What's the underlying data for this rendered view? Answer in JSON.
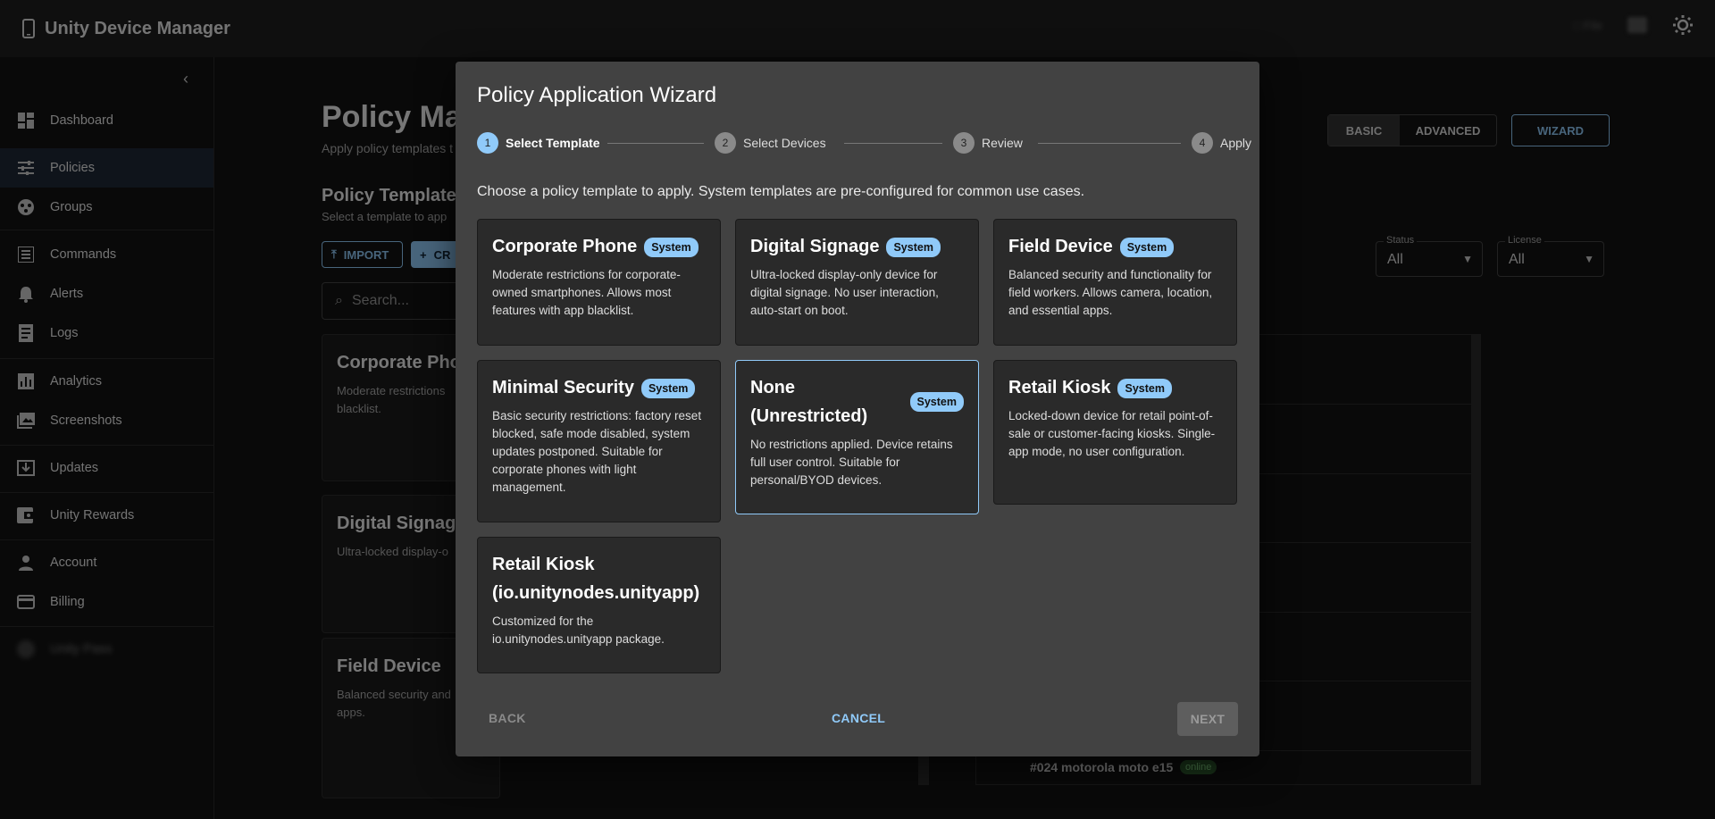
{
  "app": {
    "title": "Unity Device Manager",
    "right_blur": "□ File"
  },
  "sidebar": {
    "items": [
      {
        "label": "Dashboard",
        "icon": "dashboard-icon"
      },
      {
        "label": "Policies",
        "icon": "tune-icon"
      },
      {
        "label": "Groups",
        "icon": "groups-icon"
      },
      {
        "label": "Commands",
        "icon": "list-icon"
      },
      {
        "label": "Alerts",
        "icon": "bell-icon"
      },
      {
        "label": "Logs",
        "icon": "receipt-icon"
      },
      {
        "label": "Analytics",
        "icon": "chart-icon"
      },
      {
        "label": "Screenshots",
        "icon": "image-icon"
      },
      {
        "label": "Updates",
        "icon": "update-icon"
      },
      {
        "label": "Unity Rewards",
        "icon": "wallet-icon"
      },
      {
        "label": "Account",
        "icon": "person-icon"
      },
      {
        "label": "Billing",
        "icon": "card-icon"
      }
    ],
    "blurred_user": "Unity Pass"
  },
  "background": {
    "page_title": "Policy Ma",
    "page_subtitle": "Apply policy templates t",
    "section_title": "Policy Templates",
    "section_subtitle": "Select a template to app",
    "import_label": "IMPORT",
    "create_label": "CR",
    "search_placeholder": "Search...",
    "view_basic": "BASIC",
    "view_advanced": "ADVANCED",
    "wizard_label": "WIZARD",
    "status_label": "Status",
    "status_value": "All",
    "license_label": "License",
    "license_value": "All",
    "cards": [
      {
        "title": "Corporate Phon",
        "desc": "Moderate restrictions",
        "desc2": "blacklist."
      },
      {
        "title": "Digital Signage",
        "desc": "Ultra-locked display-o",
        "desc2": ""
      },
      {
        "title": "Field Device",
        "desc": "Balanced security and",
        "desc2": "apps."
      }
    ],
    "device_row": {
      "name": "#024 motorola moto e15",
      "status": "online"
    }
  },
  "wizard": {
    "title": "Policy Application Wizard",
    "steps": [
      {
        "num": "1",
        "label": "Select Template"
      },
      {
        "num": "2",
        "label": "Select Devices"
      },
      {
        "num": "3",
        "label": "Review"
      },
      {
        "num": "4",
        "label": "Apply"
      }
    ],
    "intro": "Choose a policy template to apply. System templates are pre-configured for common use cases.",
    "templates": [
      {
        "name": "Corporate Phone",
        "badge": "System",
        "desc": "Moderate restrictions for corporate-owned smartphones. Allows most features with app blacklist."
      },
      {
        "name": "Digital Signage",
        "badge": "System",
        "desc": "Ultra-locked display-only device for digital signage. No user interaction, auto-start on boot."
      },
      {
        "name": "Field Device",
        "badge": "System",
        "desc": "Balanced security and functionality for field workers. Allows camera, location, and essential apps."
      },
      {
        "name": "Minimal Security",
        "badge": "System",
        "desc": "Basic security restrictions: factory reset blocked, safe mode disabled, system updates postponed. Suitable for corporate phones with light management."
      },
      {
        "name": "None (Unrestricted)",
        "badge": "System",
        "desc": "No restrictions applied. Device retains full user control. Suitable for personal/BYOD devices."
      },
      {
        "name": "Retail Kiosk",
        "badge": "System",
        "desc": "Locked-down device for retail point-of-sale or customer-facing kiosks. Single-app mode, no user configuration."
      },
      {
        "name": "Retail Kiosk (io.unitynodes.unityapp)",
        "badge": "",
        "desc": "Customized for the io.unitynodes.unityapp package."
      }
    ],
    "back_label": "BACK",
    "cancel_label": "CANCEL",
    "next_label": "NEXT"
  }
}
